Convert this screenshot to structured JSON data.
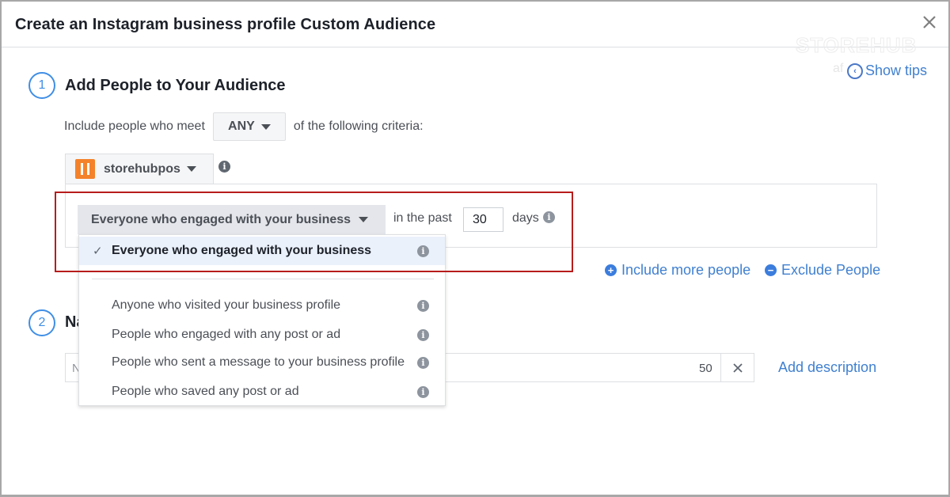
{
  "dialog": {
    "title": "Create an Instagram business profile Custom Audience",
    "close_icon": "close-icon",
    "watermark": "STOREHUB",
    "watermark_sub": "af",
    "show_tips_label": "Show tips"
  },
  "step1": {
    "number": "1",
    "title": "Add People to Your Audience",
    "criteria_prefix": "Include people who meet",
    "match_select": "ANY",
    "criteria_suffix": "of the following criteria:",
    "account": {
      "name": "storehubpos",
      "brand_color": "#f4822a"
    },
    "rule": {
      "selected_option": "Everyone who engaged with your business",
      "past_label": "in the past",
      "days_value": "30",
      "days_label": "days"
    },
    "dropdown": {
      "selected": {
        "check": "✓",
        "label": "Everyone who engaged with your business"
      },
      "options": [
        {
          "label": "Anyone who visited your business profile"
        },
        {
          "label": "People who engaged with any post or ad"
        },
        {
          "label": "People who sent a message to your business profile"
        },
        {
          "label": "People who saved any post or ad"
        }
      ]
    },
    "include_more_label": "Include more people",
    "exclude_label": "Exclude People"
  },
  "step2": {
    "number": "2",
    "title_visible": "Na",
    "name_placeholder_visible": "N",
    "char_count": "50",
    "add_description_label": "Add description"
  },
  "colors": {
    "accent": "#3f8ee6",
    "link": "#4080d0",
    "highlight_border": "#b71c1c",
    "selected_row_bg": "#ebf1fb"
  }
}
